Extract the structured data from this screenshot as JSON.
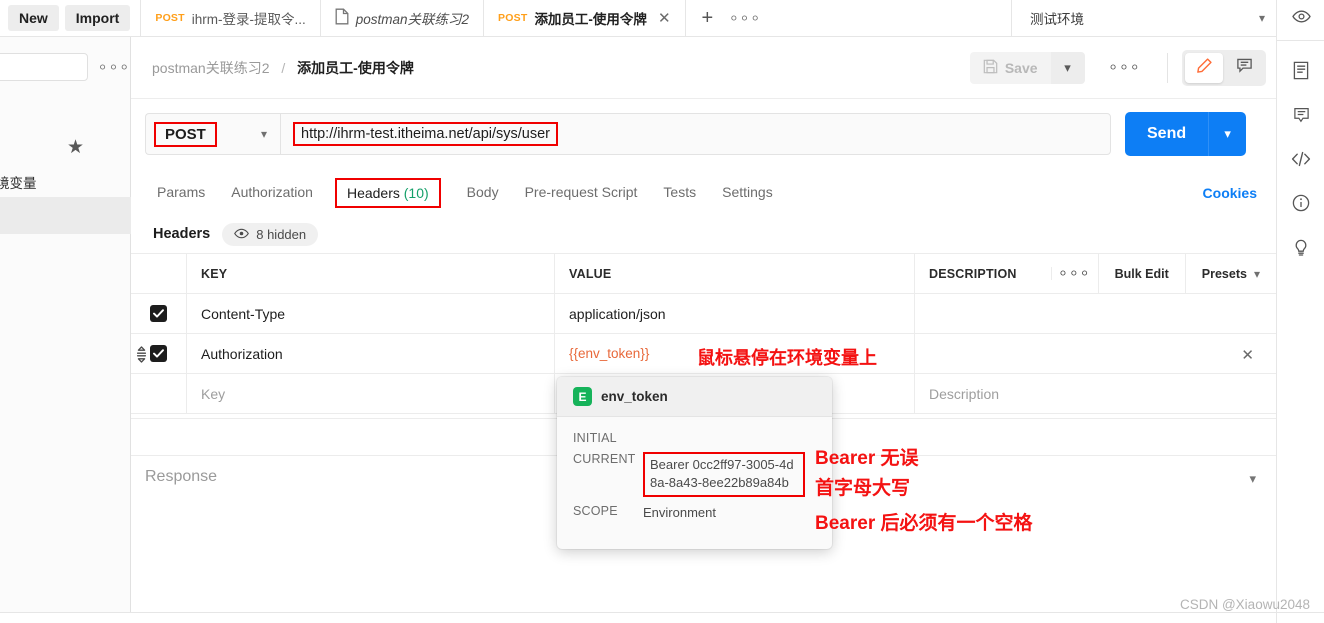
{
  "topbar": {
    "new_label": "New",
    "import_label": "Import",
    "tabs": [
      {
        "method": "POST",
        "name": "ihrm-登录-提取令...",
        "type": "request",
        "active": false,
        "closable": false
      },
      {
        "method": "",
        "name": "postman关联练习2",
        "type": "collection",
        "active": false,
        "closable": false
      },
      {
        "method": "POST",
        "name": "添加员工-使用令牌",
        "type": "request",
        "active": true,
        "closable": true
      }
    ],
    "add_tab_icon": "plus-icon",
    "tab_options_icon": "more-horizontal-icon",
    "environment": "测试环境",
    "environment_chevron": "chevron-down-icon",
    "eye_icon": "eye-icon"
  },
  "sidebar": {
    "search_placeholder": "",
    "more_icon": "more-horizontal-icon",
    "star_icon": "star-icon",
    "label": "境变量"
  },
  "request_header": {
    "breadcrumb_collection": "postman关联练习2",
    "breadcrumb_separator": "/",
    "breadcrumb_current": "添加员工-使用令牌",
    "save_label": "Save",
    "save_icon": "floppy-disk-icon",
    "save_chevron": "chevron-down-icon",
    "more_icon": "more-horizontal-icon",
    "edit_icon": "pencil-icon",
    "comment_icon": "comment-icon"
  },
  "url_bar": {
    "method": "POST",
    "method_chevron": "chevron-down-icon",
    "url": "http://ihrm-test.itheima.net/api/sys/user",
    "send_label": "Send",
    "send_chevron": "chevron-down-icon"
  },
  "request_tabs": {
    "items": [
      {
        "label": "Params",
        "selected": false,
        "highlighted": false,
        "count": ""
      },
      {
        "label": "Authorization",
        "selected": false,
        "highlighted": false,
        "count": ""
      },
      {
        "label": "Headers",
        "selected": true,
        "highlighted": true,
        "count": "(10)"
      },
      {
        "label": "Body",
        "selected": false,
        "highlighted": false,
        "count": ""
      },
      {
        "label": "Pre-request Script",
        "selected": false,
        "highlighted": false,
        "count": ""
      },
      {
        "label": "Tests",
        "selected": false,
        "highlighted": false,
        "count": ""
      },
      {
        "label": "Settings",
        "selected": false,
        "highlighted": false,
        "count": ""
      }
    ],
    "cookies_label": "Cookies"
  },
  "headers_panel": {
    "title": "Headers",
    "hidden_label": "8 hidden",
    "hidden_eye_icon": "eye-icon",
    "columns": {
      "key": "KEY",
      "value": "VALUE",
      "description": "DESCRIPTION"
    },
    "more_icon": "more-horizontal-icon",
    "bulk_edit_label": "Bulk Edit",
    "presets_label": "Presets",
    "presets_chevron": "chevron-down-icon",
    "rows": [
      {
        "checked": true,
        "key": "Content-Type",
        "value": "application/json",
        "description": "",
        "is_variable": false,
        "has_drag_handle": false,
        "has_close": false
      },
      {
        "checked": true,
        "key": "Authorization",
        "value": "{{env_token}}",
        "description": "",
        "is_variable": true,
        "has_drag_handle": true,
        "has_close": true,
        "close_icon": "close-icon",
        "drag_icon": "drag-handle-icon"
      },
      {
        "checked": false,
        "key": "Key",
        "value": "",
        "description": "Description",
        "is_placeholder": true,
        "has_drag_handle": false,
        "has_close": false
      }
    ]
  },
  "variable_popup": {
    "badge": "E",
    "name": "env_token",
    "rows": [
      {
        "label": "INITIAL",
        "value": "",
        "boxed": false
      },
      {
        "label": "CURRENT",
        "value": "Bearer 0cc2ff97-3005-4d8a-8a43-8ee22b89a84b",
        "boxed": true
      },
      {
        "label": "SCOPE",
        "value": "Environment",
        "boxed": false
      }
    ]
  },
  "autocomplete": {
    "badge": "E",
    "name": "env_token"
  },
  "response": {
    "label": "Response",
    "chevron": "chevron-down-icon"
  },
  "annotations": [
    {
      "id": "hover-note",
      "text": "鼠标悬停在环境变量上"
    },
    {
      "id": "bearer-ok",
      "text": "Bearer 无误"
    },
    {
      "id": "capital-note",
      "text": "首字母大写"
    },
    {
      "id": "space-note",
      "text": "Bearer 后必须有一个空格"
    }
  ],
  "right_rail": {
    "icons": [
      "eye-icon",
      "documentation-icon",
      "comment-icon",
      "code-icon",
      "info-icon",
      "lightbulb-icon"
    ]
  },
  "watermark": "CSDN @Xiaowu2048",
  "colors": {
    "accent_blue": "#0d7ef5",
    "method_orange": "#ff9f1a",
    "variable_orange": "#e8683a",
    "annotation_red": "#f41212",
    "env_green": "#16b35a",
    "count_green": "#15a06a"
  }
}
